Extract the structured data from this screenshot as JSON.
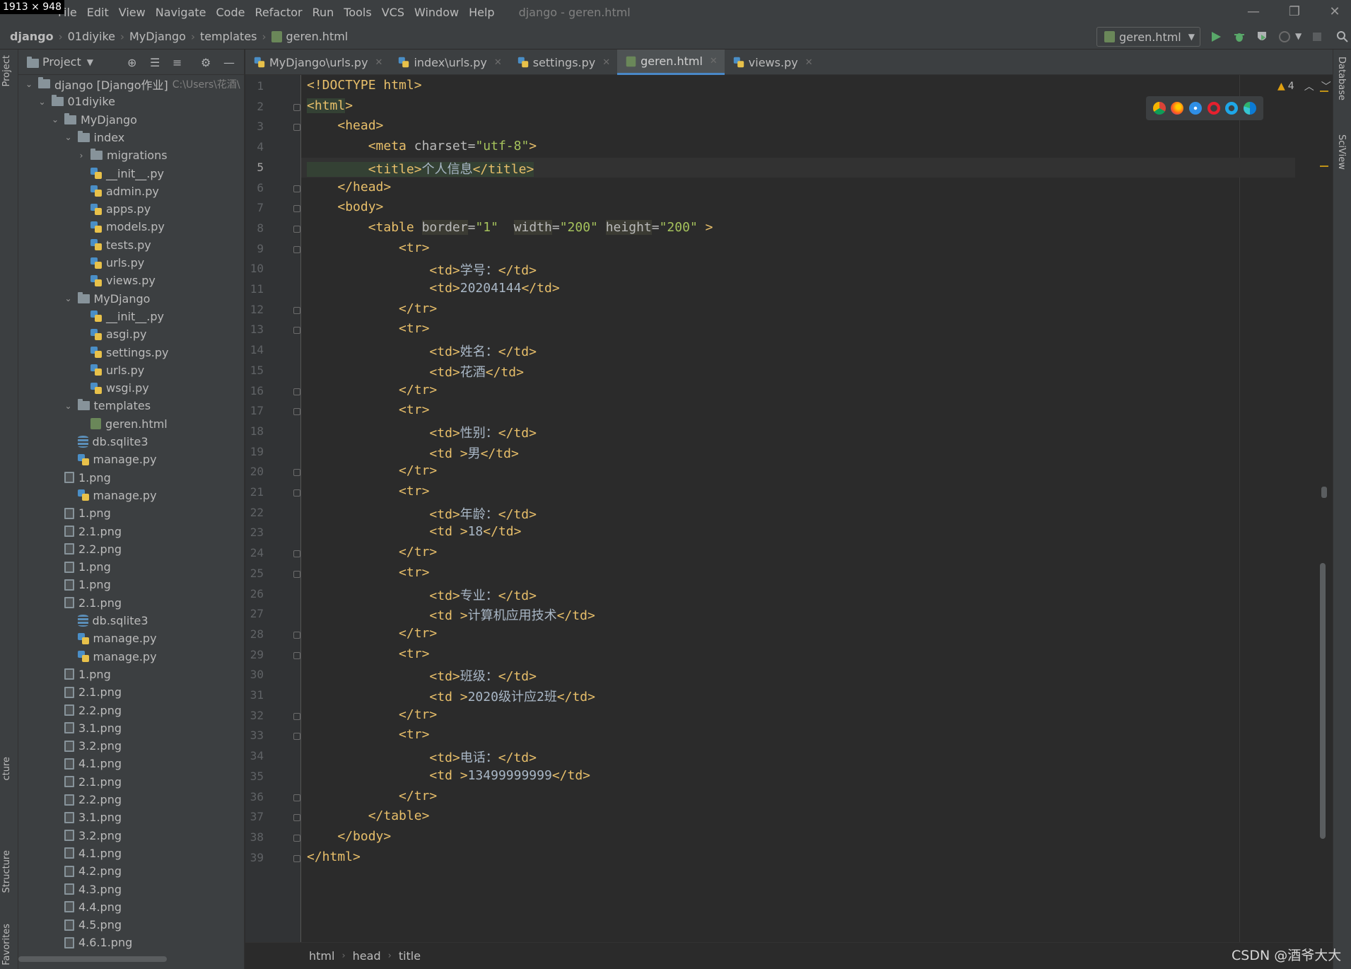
{
  "dimension_badge": "1913 × 948",
  "menu": {
    "items": [
      "File",
      "Edit",
      "View",
      "Navigate",
      "Code",
      "Refactor",
      "Run",
      "Tools",
      "VCS",
      "Window",
      "Help"
    ],
    "window_title": "django - geren.html"
  },
  "nav": {
    "crumbs": [
      "django",
      "01diyike",
      "MyDjango",
      "templates",
      "geren.html"
    ],
    "run_config": "geren.html"
  },
  "side_tabs": {
    "project": "Project",
    "structure": "Structure",
    "structure_partial": "cture",
    "favorites": "Favorites",
    "database": "Database",
    "sciview": "SciView"
  },
  "project": {
    "title": "Project",
    "root_label": "django [Django作业]",
    "root_path": "C:\\Users\\花酒\\"
  },
  "tree": [
    {
      "label": "01diyike",
      "type": "folder",
      "depth": 1,
      "arrow": "open"
    },
    {
      "label": "MyDjango",
      "type": "folder",
      "depth": 2,
      "arrow": "open"
    },
    {
      "label": "index",
      "type": "folder",
      "depth": 3,
      "arrow": "open"
    },
    {
      "label": "migrations",
      "type": "folder",
      "depth": 4,
      "arrow": "closed"
    },
    {
      "label": "__init__.py",
      "type": "py",
      "depth": 4
    },
    {
      "label": "admin.py",
      "type": "py",
      "depth": 4
    },
    {
      "label": "apps.py",
      "type": "py",
      "depth": 4
    },
    {
      "label": "models.py",
      "type": "py",
      "depth": 4
    },
    {
      "label": "tests.py",
      "type": "py",
      "depth": 4
    },
    {
      "label": "urls.py",
      "type": "py",
      "depth": 4
    },
    {
      "label": "views.py",
      "type": "py",
      "depth": 4
    },
    {
      "label": "MyDjango",
      "type": "folder",
      "depth": 3,
      "arrow": "open"
    },
    {
      "label": "__init__.py",
      "type": "py",
      "depth": 4
    },
    {
      "label": "asgi.py",
      "type": "py",
      "depth": 4
    },
    {
      "label": "settings.py",
      "type": "py",
      "depth": 4
    },
    {
      "label": "urls.py",
      "type": "py",
      "depth": 4
    },
    {
      "label": "wsgi.py",
      "type": "py",
      "depth": 4
    },
    {
      "label": "templates",
      "type": "folder",
      "depth": 3,
      "arrow": "open"
    },
    {
      "label": "geren.html",
      "type": "html",
      "depth": 4
    },
    {
      "label": "db.sqlite3",
      "type": "db",
      "depth": 3
    },
    {
      "label": "manage.py",
      "type": "py",
      "depth": 3
    },
    {
      "label": "1.png",
      "type": "img",
      "depth": 2
    },
    {
      "label": "manage.py",
      "type": "py",
      "depth": 3
    },
    {
      "label": "1.png",
      "type": "img",
      "depth": 2
    },
    {
      "label": "2.1.png",
      "type": "img",
      "depth": 2
    },
    {
      "label": "2.2.png",
      "type": "img",
      "depth": 2
    },
    {
      "label": "1.png",
      "type": "img",
      "depth": 2
    },
    {
      "label": "1.png",
      "type": "img",
      "depth": 2
    },
    {
      "label": "2.1.png",
      "type": "img",
      "depth": 2
    },
    {
      "label": "db.sqlite3",
      "type": "db",
      "depth": 3
    },
    {
      "label": "manage.py",
      "type": "py",
      "depth": 3
    },
    {
      "label": "manage.py",
      "type": "py",
      "depth": 3
    },
    {
      "label": "1.png",
      "type": "img",
      "depth": 2
    },
    {
      "label": "2.1.png",
      "type": "img",
      "depth": 2
    },
    {
      "label": "2.2.png",
      "type": "img",
      "depth": 2
    },
    {
      "label": "3.1.png",
      "type": "img",
      "depth": 2
    },
    {
      "label": "3.2.png",
      "type": "img",
      "depth": 2
    },
    {
      "label": "4.1.png",
      "type": "img",
      "depth": 2
    },
    {
      "label": "2.1.png",
      "type": "img",
      "depth": 2
    },
    {
      "label": "2.2.png",
      "type": "img",
      "depth": 2
    },
    {
      "label": "3.1.png",
      "type": "img",
      "depth": 2
    },
    {
      "label": "3.2.png",
      "type": "img",
      "depth": 2
    },
    {
      "label": "4.1.png",
      "type": "img",
      "depth": 2
    },
    {
      "label": "4.2.png",
      "type": "img",
      "depth": 2
    },
    {
      "label": "4.3.png",
      "type": "img",
      "depth": 2
    },
    {
      "label": "4.4.png",
      "type": "img",
      "depth": 2
    },
    {
      "label": "4.5.png",
      "type": "img",
      "depth": 2
    },
    {
      "label": "4.6.1.png",
      "type": "img",
      "depth": 2
    }
  ],
  "tabs": [
    {
      "label": "MyDjango\\urls.py",
      "icon": "py",
      "active": false
    },
    {
      "label": "index\\urls.py",
      "icon": "py",
      "active": false
    },
    {
      "label": "settings.py",
      "icon": "py",
      "active": false
    },
    {
      "label": "geren.html",
      "icon": "html",
      "active": true
    },
    {
      "label": "views.py",
      "icon": "py",
      "active": false
    }
  ],
  "editor": {
    "warnings": "4",
    "current_line": 5,
    "code_lines": [
      "<!DOCTYPE html>",
      "<html>",
      "    <head>",
      "        <meta charset=\"utf-8\">",
      "        <title>个人信息</title>",
      "    </head>",
      "    <body>",
      "        <table border=\"1\"  width=\"200\" height=\"200\" >",
      "            <tr>",
      "                <td>学号：</td>",
      "                <td>20204144</td>",
      "            </tr>",
      "            <tr>",
      "                <td>姓名：</td>",
      "                <td>花酒</td>",
      "            </tr>",
      "            <tr>",
      "                <td>性别：</td>",
      "                <td >男</td>",
      "            </tr>",
      "            <tr>",
      "                <td>年龄：</td>",
      "                <td >18</td>",
      "            </tr>",
      "            <tr>",
      "                <td>专业：</td>",
      "                <td >计算机应用技术</td>",
      "            </tr>",
      "            <tr>",
      "                <td>班级：</td>",
      "                <td >2020级计应2班</td>",
      "            </tr>",
      "            <tr>",
      "                <td>电话：</td>",
      "                <td >13499999999</td>",
      "            </tr>",
      "        </table>",
      "    </body>",
      "</html>"
    ]
  },
  "breadcrumb": [
    "html",
    "head",
    "title"
  ],
  "watermark": "CSDN @酒爷大大",
  "colors": {
    "tag": "#e8bf6a",
    "attribute": "#bababa",
    "string": "#a5c25c",
    "text": "#a9b7c6",
    "accent": "#4a88c7"
  }
}
